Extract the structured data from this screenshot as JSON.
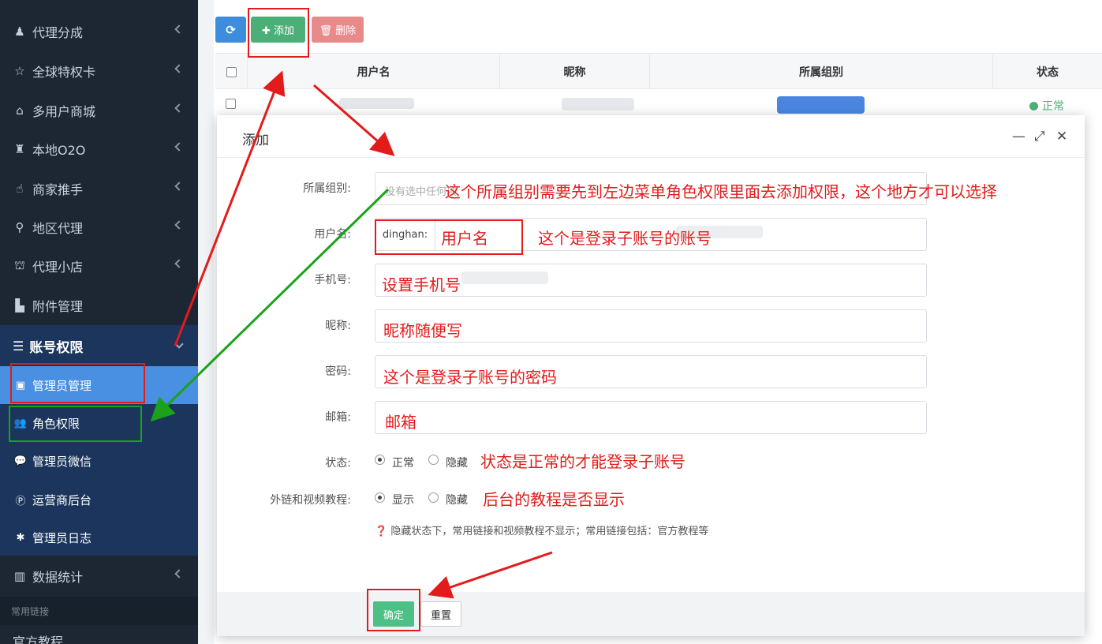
{
  "sidebar": {
    "items": [
      {
        "label": "代理分成",
        "icon": "agent-icon"
      },
      {
        "label": "全球特权卡",
        "icon": "card-icon"
      },
      {
        "label": "多用户商城",
        "icon": "shop-icon"
      },
      {
        "label": "本地O2O",
        "icon": "o2o-icon"
      },
      {
        "label": "商家推手",
        "icon": "hand-icon"
      },
      {
        "label": "地区代理",
        "icon": "location-pin-icon"
      },
      {
        "label": "代理小店",
        "icon": "bank-icon"
      },
      {
        "label": "附件管理",
        "icon": "file-icon"
      }
    ],
    "group": {
      "label": "账号权限",
      "icon": "list-icon"
    },
    "sub_items": [
      {
        "label": "管理员管理",
        "icon": "user-card-icon"
      },
      {
        "label": "角色权限",
        "icon": "users-icon"
      },
      {
        "label": "管理员微信",
        "icon": "wechat-icon"
      },
      {
        "label": "运营商后台",
        "icon": "p-circle-icon"
      },
      {
        "label": "管理员日志",
        "icon": "bug-icon"
      }
    ],
    "stats": {
      "label": "数据统计",
      "icon": "chart-icon"
    },
    "section_label": "常用链接",
    "bottom_partial": "官方教程"
  },
  "toolbar": {
    "refresh_glyph": "⟳",
    "add_label": "✚ 添加",
    "delete_label": "🗑 删除"
  },
  "table": {
    "headers": [
      "用户名",
      "昵称",
      "所属组别",
      "状态"
    ],
    "row_status": "正常"
  },
  "modal": {
    "title": "添加",
    "fields": {
      "group_label": "所属组别:",
      "group_placeholder": "没有选中任何项",
      "username_label": "用户名:",
      "username_prefix": "dinghan:",
      "mobile_label": "手机号:",
      "nickname_label": "昵称:",
      "password_label": "密码:",
      "email_label": "邮箱:",
      "status_label": "状态:",
      "status_options": [
        "正常",
        "隐藏"
      ],
      "tutorial_label": "外链和视频教程:",
      "tutorial_options": [
        "显示",
        "隐藏"
      ]
    },
    "tip": "❓ 隐藏状态下，常用链接和视频教程不显示；常用链接包括：官方教程等",
    "ok_label": "确定",
    "reset_label": "重置"
  },
  "annotations": {
    "group": "这个所属组别需要先到左边菜单角色权限里面去添加权限，这个地方才可以选择",
    "username_value": "用户名",
    "username_note": "这个是登录子账号的账号",
    "mobile": "设置手机号",
    "nickname": "昵称随便写",
    "password": "这个是登录子账号的密码",
    "email": "邮箱",
    "status": "状态是正常的才能登录子账号",
    "tutorial": "后台的教程是否显示"
  },
  "colors": {
    "sidebar_bg": "#1c2733",
    "group_bg": "#1b355c",
    "active_bg": "#4a90e2",
    "add_btn": "#4caf77",
    "delete_btn": "#e8898a",
    "refresh_btn": "#3c8dde",
    "annotation_red": "#e31b1b",
    "annotation_green": "#1aa31a"
  }
}
